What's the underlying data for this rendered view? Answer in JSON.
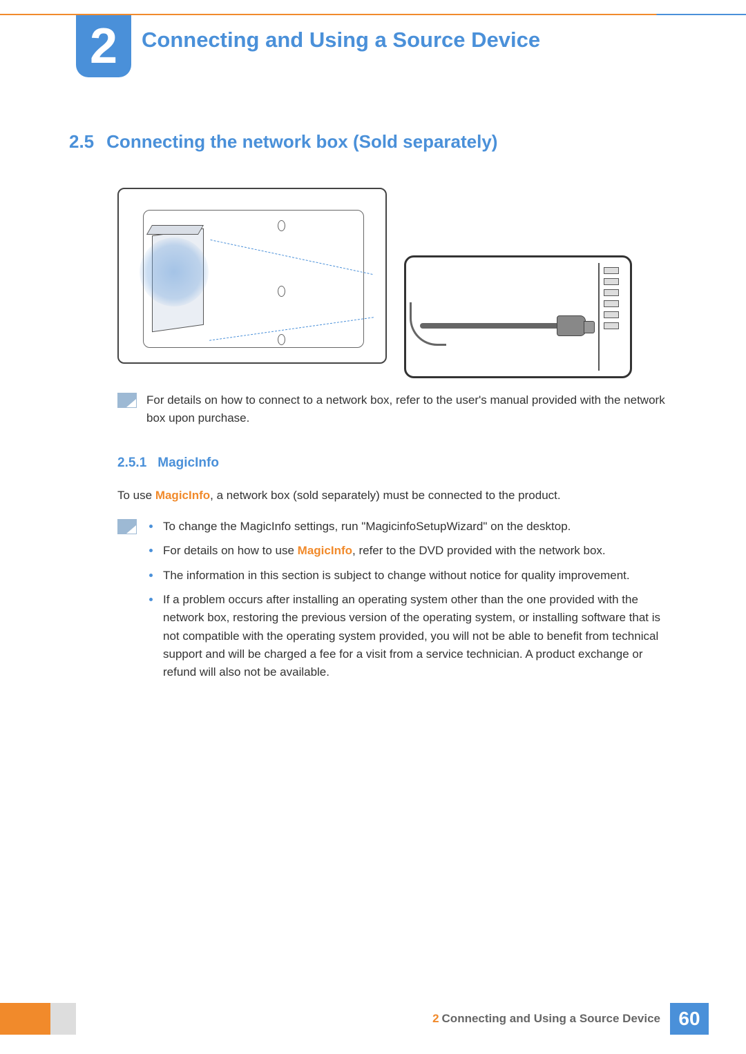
{
  "chapter": {
    "number": "2",
    "title": "Connecting and Using a Source Device"
  },
  "section": {
    "number": "2.5",
    "title": "Connecting the network box (Sold separately)"
  },
  "note1": "For details on how to connect to a network box, refer to the user's manual provided with the network box upon purchase.",
  "subsection": {
    "number": "2.5.1",
    "title": "MagicInfo"
  },
  "paragraph": {
    "pre": "To use ",
    "term": "MagicInfo",
    "post": ", a network box (sold separately) must be connected to the product."
  },
  "bullets": {
    "b1": "To change the MagicInfo settings, run \"MagicinfoSetupWizard\" on the desktop.",
    "b2_pre": "For details on how to use ",
    "b2_term": "MagicInfo",
    "b2_post": ", refer to the DVD provided with the network box.",
    "b3": "The information in this section is subject to change without notice for quality improvement.",
    "b4": "If a problem occurs after installing an operating system other than the one provided with the network box, restoring the previous version of the operating system, or installing software that is not compatible with the operating system provided, you will not be able to benefit from technical support and will be charged a fee for a visit from a service technician. A product exchange or refund will also not be available."
  },
  "footer": {
    "chapter_num": "2",
    "chapter_title": "Connecting and Using a Source Device",
    "page": "60"
  }
}
